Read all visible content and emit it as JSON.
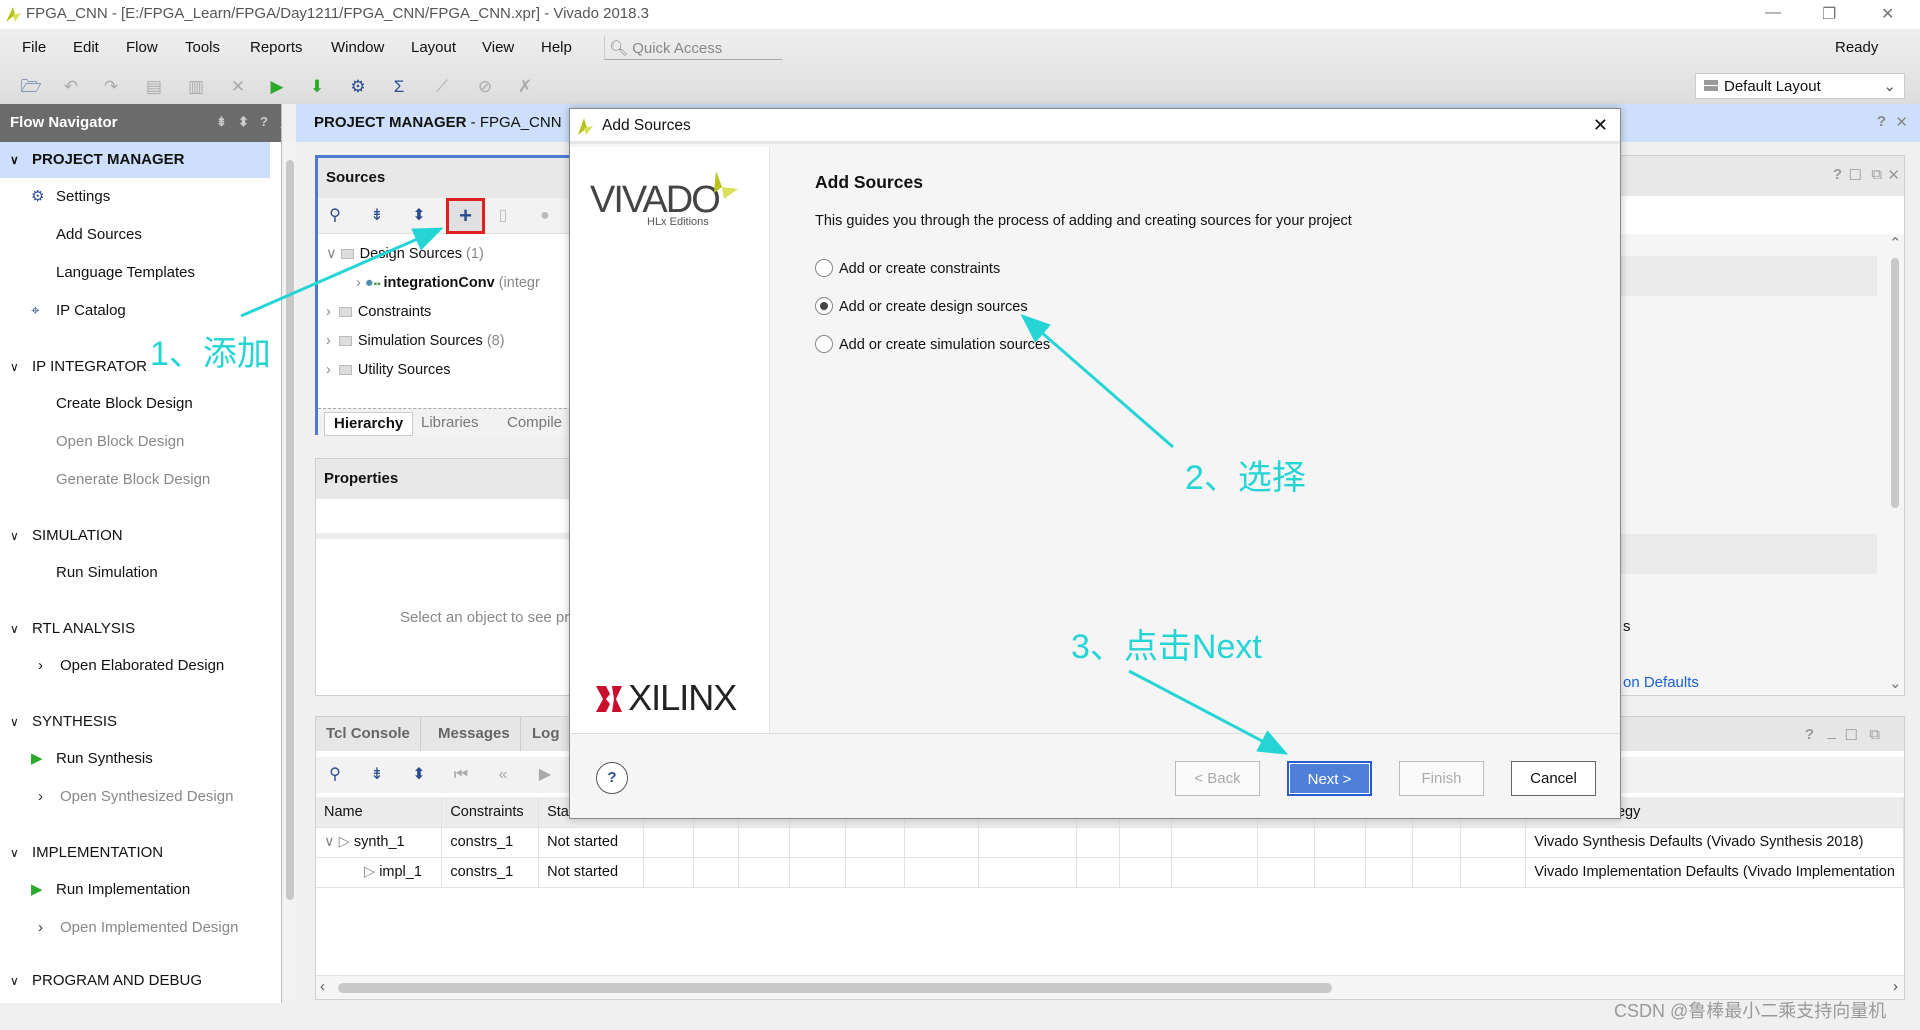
{
  "window": {
    "title": "FPGA_CNN - [E:/FPGA_Learn/FPGA/Day1211/FPGA_CNN/FPGA_CNN.xpr] - Vivado 2018.3"
  },
  "menu": [
    "File",
    "Edit",
    "Flow",
    "Tools",
    "Reports",
    "Window",
    "Layout",
    "View",
    "Help"
  ],
  "quick_access": {
    "placeholder": "Quick Access"
  },
  "status": "Ready",
  "layout_select": "Default Layout",
  "toolbar": [
    "open-project",
    "undo",
    "redo",
    "copy",
    "paste",
    "delete",
    "run",
    "program-bitstream",
    "settings",
    "report-sum",
    "disabled-1",
    "disabled-2",
    "disabled-3"
  ],
  "flow_nav": {
    "title": "Flow Navigator",
    "sections": [
      {
        "label": "PROJECT MANAGER",
        "items": [
          {
            "label": "Settings"
          },
          {
            "label": "Add Sources"
          },
          {
            "label": "Language Templates"
          },
          {
            "label": "IP Catalog"
          }
        ]
      },
      {
        "label": "IP INTEGRATOR",
        "items": [
          {
            "label": "Create Block Design"
          },
          {
            "label": "Open Block Design"
          },
          {
            "label": "Generate Block Design"
          }
        ]
      },
      {
        "label": "SIMULATION",
        "items": [
          {
            "label": "Run Simulation"
          }
        ]
      },
      {
        "label": "RTL ANALYSIS",
        "items": [
          {
            "label": "Open Elaborated Design"
          }
        ]
      },
      {
        "label": "SYNTHESIS",
        "items": [
          {
            "label": "Run Synthesis"
          },
          {
            "label": "Open Synthesized Design"
          }
        ]
      },
      {
        "label": "IMPLEMENTATION",
        "items": [
          {
            "label": "Run Implementation"
          },
          {
            "label": "Open Implemented Design"
          }
        ]
      },
      {
        "label": "PROGRAM AND DEBUG"
      }
    ]
  },
  "main_header": {
    "section": "PROJECT MANAGER",
    "project": " - FPGA_CNN"
  },
  "sources": {
    "title": "Sources",
    "tree": [
      {
        "label": "Design Sources",
        "count": "(1)"
      },
      {
        "label": "integrationConv",
        "suffix": "(integr"
      },
      {
        "label": "Constraints"
      },
      {
        "label": "Simulation Sources",
        "count": "(8)"
      },
      {
        "label": "Utility Sources"
      }
    ],
    "tabs": [
      "Hierarchy",
      "Libraries",
      "Compile"
    ]
  },
  "properties": {
    "title": "Properties",
    "empty_text": "Select an object to see properties"
  },
  "summary": {
    "frag1": "s",
    "link_frag": "on Defaults"
  },
  "bottom": {
    "tabs": [
      "Tcl Console",
      "Messages",
      "Log"
    ],
    "columns": [
      "Name",
      "Constraints",
      "Status",
      "Strategy"
    ],
    "rows": [
      {
        "name": "synth_1",
        "constraints": "constrs_1",
        "status": "Not started",
        "strategy": "Vivado Synthesis Defaults (Vivado Synthesis 2018)"
      },
      {
        "name": "impl_1",
        "constraints": "constrs_1",
        "status": "Not started",
        "strategy": "Vivado Implementation Defaults (Vivado Implementation"
      }
    ]
  },
  "dialog": {
    "title": "Add Sources",
    "logo_vivado": "VIVADO",
    "logo_sub": "HLx Editions",
    "logo_xilinx": "XILINX",
    "heading": "Add Sources",
    "description": "This guides you through the process of adding and creating sources for your project",
    "options": [
      {
        "label": "Add or create constraints",
        "selected": false
      },
      {
        "label": "Add or create design sources",
        "selected": true
      },
      {
        "label": "Add or create simulation sources",
        "selected": false
      }
    ],
    "buttons": {
      "help": "?",
      "back": "< Back",
      "next": "Next >",
      "finish": "Finish",
      "cancel": "Cancel"
    }
  },
  "annotations": {
    "step1": "1、添加",
    "step2": "2、选择",
    "step3": "3、点击Next",
    "color": "#25d5d5",
    "highlight": "#e02020"
  },
  "watermark": "CSDN @鲁棒最小二乘支持向量机"
}
